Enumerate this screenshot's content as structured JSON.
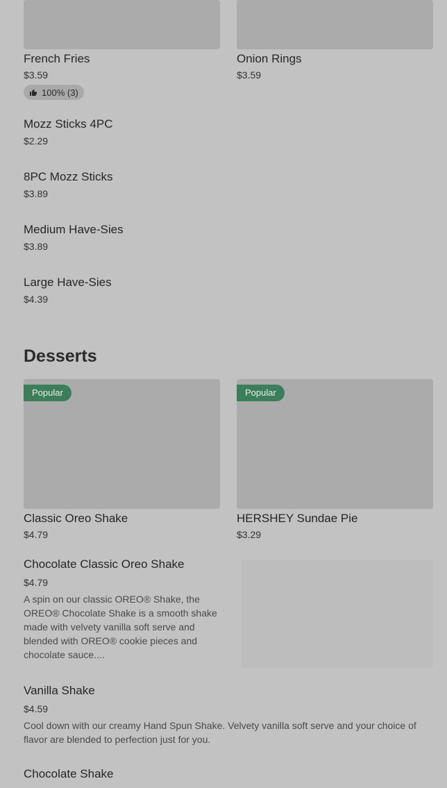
{
  "sides": {
    "grid": [
      {
        "name": "French Fries",
        "price": "$3.59",
        "rating": "100% (3)"
      },
      {
        "name": "Onion Rings",
        "price": "$3.59"
      }
    ],
    "list": [
      {
        "name": "Mozz Sticks 4PC",
        "price": "$2.29"
      },
      {
        "name": "8PC Mozz Sticks",
        "price": "$3.89"
      },
      {
        "name": "Medium Have-Sies",
        "price": "$3.89"
      },
      {
        "name": "Large Have-Sies",
        "price": "$4.39"
      }
    ]
  },
  "desserts": {
    "title": "Desserts",
    "grid": [
      {
        "badge": "Popular",
        "name": "Classic Oreo Shake",
        "price": "$4.79"
      },
      {
        "badge": "Popular",
        "name": "HERSHEY Sundae Pie",
        "price": "$3.29"
      }
    ],
    "list": [
      {
        "name": "Chocolate Classic Oreo Shake",
        "price": "$4.79",
        "description": "A spin on our classic OREO® Shake, the OREO® Chocolate Shake is a smooth shake made with velvety vanilla soft serve and blended with OREO® cookie pieces and chocolate sauce...."
      },
      {
        "name": "Vanilla Shake",
        "price": "$4.59",
        "description": "Cool down with our creamy Hand Spun Shake. Velvety vanilla soft serve and your choice of flavor are blended to perfection just for you."
      },
      {
        "name": "Chocolate Shake"
      }
    ]
  },
  "icons": {
    "thumbs_up": "thumbs-up-icon"
  },
  "colors": {
    "popular_badge": "#3d7e5a",
    "background": "#c2c2c2"
  }
}
